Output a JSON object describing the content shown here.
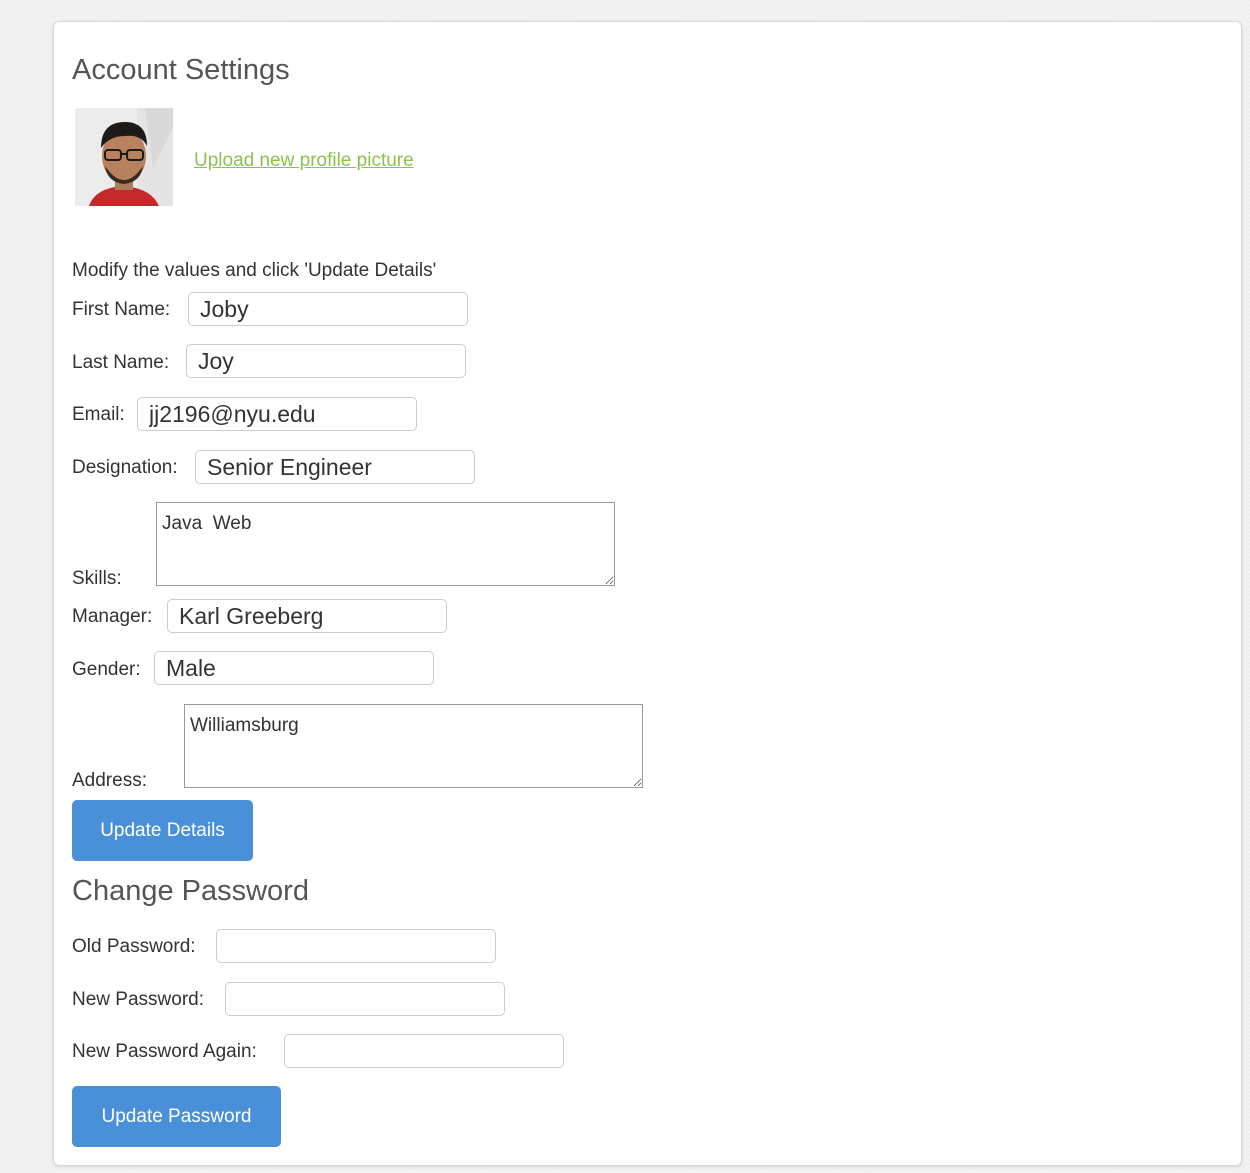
{
  "account": {
    "title": "Account Settings",
    "upload_link": "Upload new profile picture",
    "instruction": "Modify the values and click 'Update Details'",
    "fields": {
      "first_name": {
        "label": "First Name:",
        "value": "Joby"
      },
      "last_name": {
        "label": "Last Name:",
        "value": "Joy"
      },
      "email": {
        "label": "Email:",
        "value": "jj2196@nyu.edu"
      },
      "designation": {
        "label": "Designation:",
        "value": "Senior Engineer"
      },
      "skills": {
        "label": "Skills:",
        "value": "Java  Web"
      },
      "manager": {
        "label": "Manager:",
        "value": "Karl Greeberg"
      },
      "gender": {
        "label": "Gender:",
        "value": "Male"
      },
      "address": {
        "label": "Address:",
        "value": "Williamsburg"
      }
    },
    "update_button": "Update Details"
  },
  "password": {
    "title": "Change Password",
    "old_label": "Old Password:",
    "new_label": "New Password:",
    "again_label": "New Password Again:",
    "old_value": "",
    "new_value": "",
    "again_value": "",
    "update_button": "Update Password"
  },
  "colors": {
    "link": "#8cc152",
    "button": "#4a90d9",
    "heading": "#555555"
  },
  "icons": {
    "avatar": "profile-photo"
  }
}
